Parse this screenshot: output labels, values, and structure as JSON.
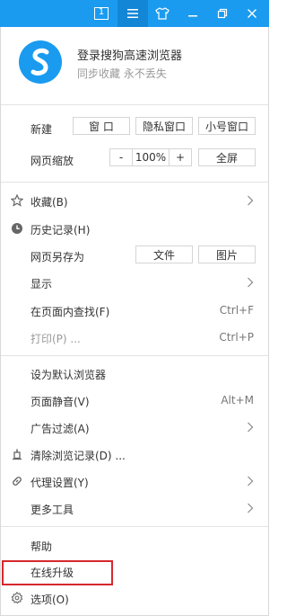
{
  "titlebar": {
    "badge_number": "1",
    "icons": [
      "one-badge-icon",
      "menu-icon",
      "skin-icon",
      "minimize-icon",
      "restore-icon",
      "close-icon"
    ],
    "color": "#1a9bf0"
  },
  "account": {
    "title": "登录搜狗高速浏览器",
    "subtitle": "同步收藏 永不丢失"
  },
  "new_row": {
    "label": "新建",
    "window": "窗 口",
    "private_window": "隐私窗口",
    "small_window": "小号窗口"
  },
  "zoom_row": {
    "label": "网页缩放",
    "minus": "-",
    "value": "100%",
    "plus": "+",
    "fullscreen": "全屏"
  },
  "menu": {
    "favorites": "收藏(B)",
    "history": "历史记录(H)",
    "save_as": "网页另存为",
    "save_file": "文件",
    "save_image": "图片",
    "display": "显示",
    "find": "在页面内查找(F)",
    "find_shortcut": "Ctrl+F",
    "print": "打印(P) ...",
    "print_shortcut": "Ctrl+P",
    "set_default": "设为默认浏览器",
    "mute": "页面静音(V)",
    "mute_shortcut": "Alt+M",
    "adblock": "广告过滤(A)",
    "clear_history": "清除浏览记录(D) ...",
    "proxy": "代理设置(Y)",
    "more_tools": "更多工具",
    "help": "帮助",
    "online_update": "在线升级",
    "options": "选项(O)"
  },
  "colors": {
    "accent": "#1a9bf0",
    "highlight_border": "#d6282c"
  }
}
